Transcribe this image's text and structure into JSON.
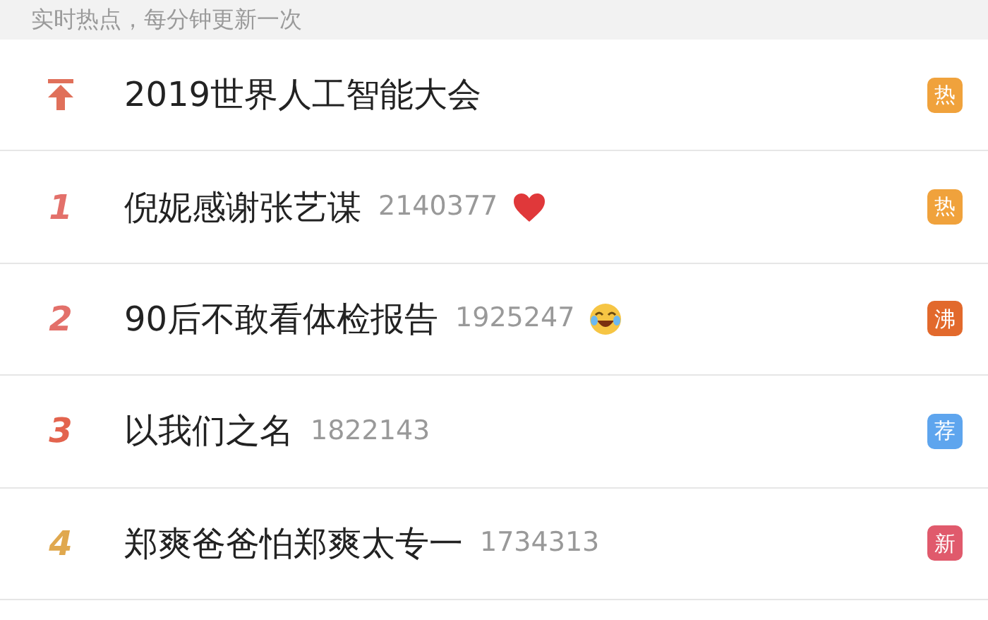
{
  "header": {
    "text": "实时热点，每分钟更新一次"
  },
  "items": [
    {
      "rank": {
        "kind": "pin",
        "color": "#e0705a"
      },
      "title": "2019世界人工智能大会",
      "badge": {
        "text": "热",
        "color": "#f0a23c"
      }
    },
    {
      "rank": {
        "kind": "number",
        "text": "1",
        "color": "#e3706a"
      },
      "title": "倪妮感谢张艺谋",
      "count": "2140377",
      "emoji": {
        "kind": "heart"
      },
      "badge": {
        "text": "热",
        "color": "#f0a23c"
      }
    },
    {
      "rank": {
        "kind": "number",
        "text": "2",
        "color": "#e3706a"
      },
      "title": "90后不敢看体检报告",
      "count": "1925247",
      "emoji": {
        "kind": "laugh"
      },
      "badge": {
        "text": "沸",
        "color": "#e2692c"
      }
    },
    {
      "rank": {
        "kind": "number",
        "text": "3",
        "color": "#e3644e"
      },
      "title": "以我们之名",
      "count": "1822143",
      "badge": {
        "text": "荐",
        "color": "#5ea5ee"
      }
    },
    {
      "rank": {
        "kind": "number",
        "text": "4",
        "color": "#e0a84e"
      },
      "title": "郑爽爸爸怕郑爽太专一",
      "count": "1734313",
      "badge": {
        "text": "新",
        "color": "#e05a6c"
      }
    }
  ]
}
